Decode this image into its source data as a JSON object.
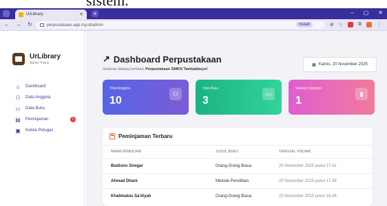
{
  "caption": {
    "text": "sistem."
  },
  "browser": {
    "tab_title": "UrLibrary",
    "url": "perpustakaan-app.my.id/admin",
    "install_label": "Install"
  },
  "sidebar": {
    "brand_title": "UrLibrary",
    "brand_subtitle": "Admin Panel",
    "items": [
      {
        "label": "Dashboard",
        "icon": "home-icon"
      },
      {
        "label": "Data Anggota",
        "icon": "users-icon"
      },
      {
        "label": "Data Buku",
        "icon": "book-icon"
      },
      {
        "label": "Peminjaman",
        "icon": "clipboard-icon",
        "badge": "1"
      },
      {
        "label": "Kelola Petugas",
        "icon": "user-badge-icon"
      }
    ]
  },
  "header": {
    "title": "Dashboard Perpustakaan",
    "subtitle_prefix": "Selamat datang kembali,",
    "subtitle_school": "Perpustakaan SMKN Tambakboyo!",
    "date": "Kamis, 20 November 2025"
  },
  "stats": [
    {
      "label": "Total Anggota",
      "value": "10",
      "icon": "users-icon",
      "color": "#5764e6"
    },
    {
      "label": "Total Buku",
      "value": "3",
      "icon": "book-icon",
      "color": "#1bb383"
    },
    {
      "label": "Sedang Dipinjam",
      "value": "1",
      "icon": "bookmark-icon",
      "color": "#e05ecf"
    }
  ],
  "loans": {
    "title": "Peminjaman Terbaru",
    "columns": [
      "NAMA PEMINJAM",
      "JUDUL BUKU",
      "TANGGAL PINJAM"
    ],
    "rows": [
      {
        "name": "Budiono Siregar",
        "book": "Orang-Orang Biasa",
        "date": "20 November 2025 pukul 17.41"
      },
      {
        "name": "Ahmad Dhani",
        "book": "Metode Penelitian",
        "date": "20 November 2025 pukul 17.38"
      },
      {
        "name": "Khalimatus Sa'diyah",
        "book": "Orang-Orang Biasa",
        "date": "20 November 2025 pukul 16.46"
      }
    ]
  }
}
